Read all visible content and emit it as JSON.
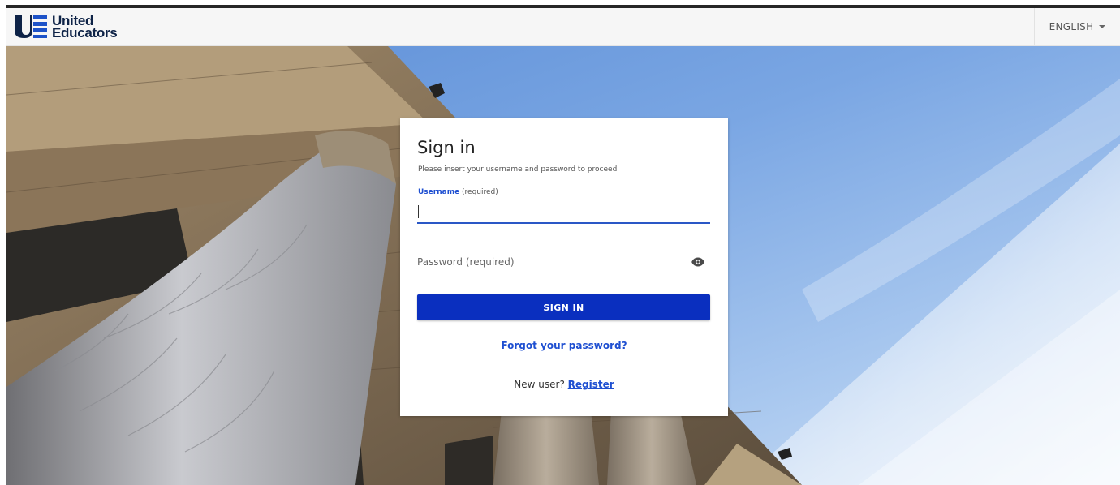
{
  "header": {
    "logo_line1": "United",
    "logo_line2": "Educators",
    "language_label": "ENGLISH"
  },
  "login": {
    "title": "Sign in",
    "subtitle": "Please insert your username and password to proceed",
    "username_label": "Username",
    "username_required": "(required)",
    "username_value": "",
    "password_placeholder": "Password (required)",
    "signin_label": "SIGN IN",
    "forgot_label": "Forgot your password?",
    "new_user_label": "New user?",
    "register_label": "Register"
  },
  "colors": {
    "primary": "#0a2fbf",
    "link": "#1e4fd1",
    "brand": "#0e2347"
  },
  "icons": {
    "logo": "ue-logo-mark",
    "language_caret": "caret-down-icon",
    "password_toggle": "eye-icon"
  }
}
